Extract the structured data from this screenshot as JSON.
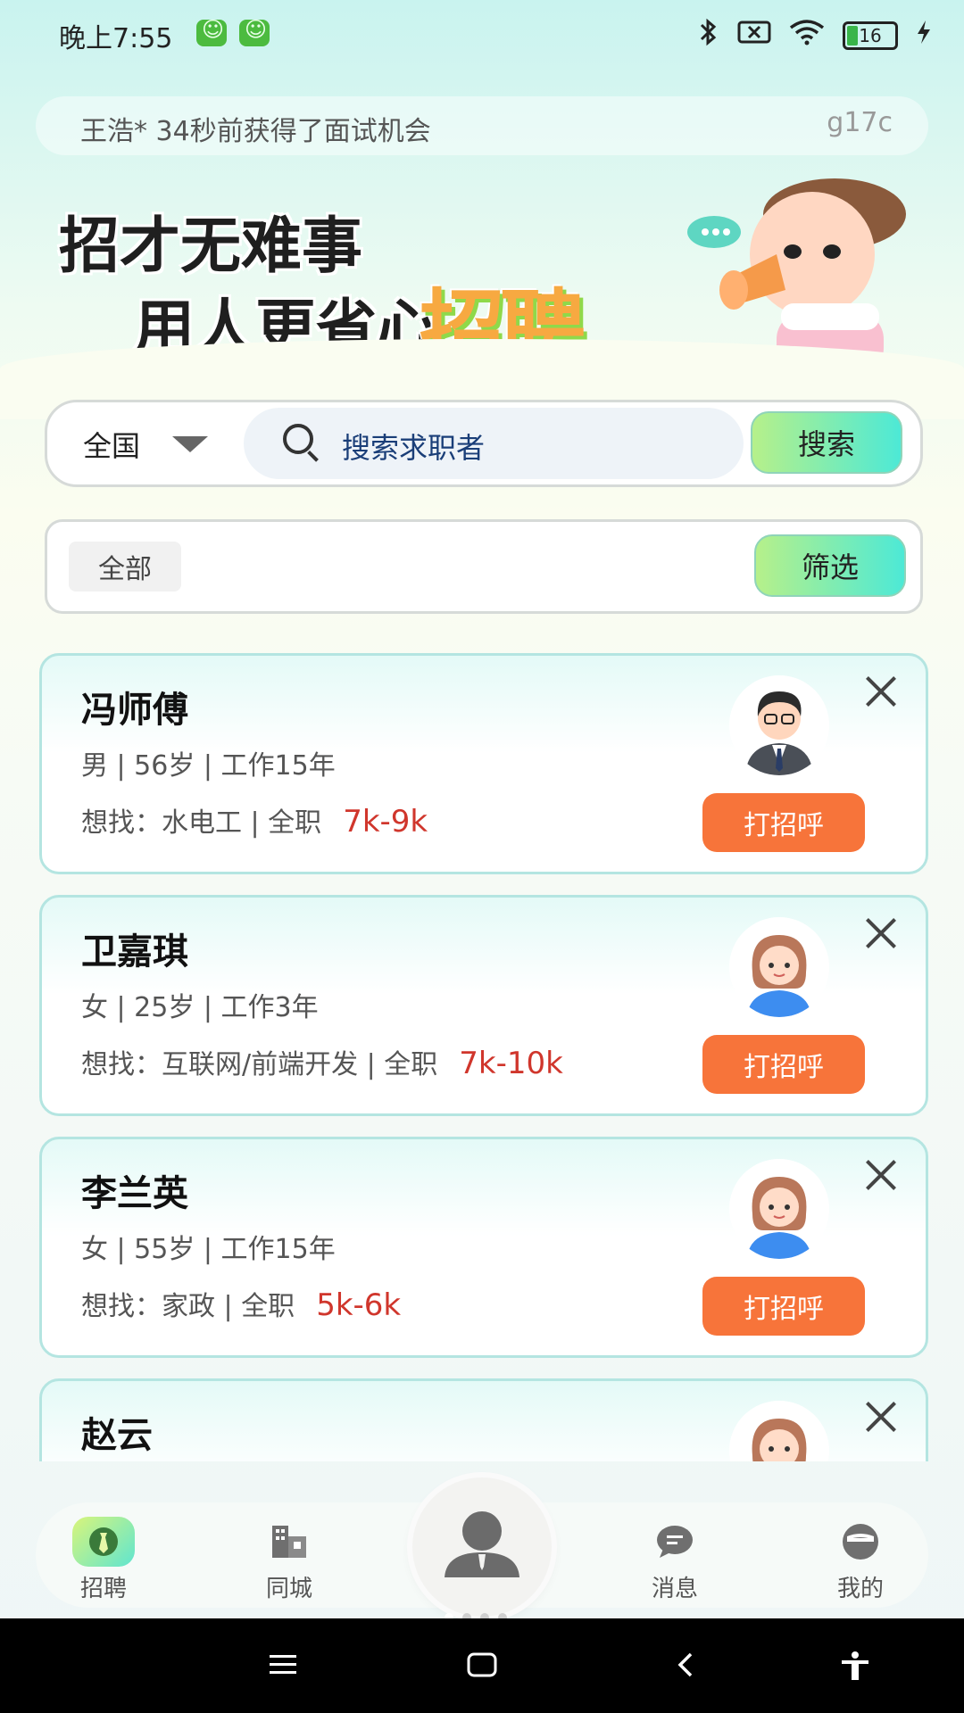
{
  "status_bar": {
    "time": "晚上7:55",
    "battery": "16",
    "icons": [
      "bluetooth-icon",
      "no-sim-icon",
      "wifi-icon",
      "battery-icon",
      "charging-icon"
    ]
  },
  "ticker": {
    "text": "王浩* 34秒前获得了面试机会",
    "code": "g17c"
  },
  "banner": {
    "line1": "招才无难事",
    "line2": "用人更省心",
    "word": "招聘"
  },
  "search": {
    "region": "全国",
    "placeholder": "搜索求职者",
    "button": "搜索"
  },
  "filter": {
    "chip": "全部",
    "button": "筛选"
  },
  "candidates": [
    {
      "name": "冯师傅",
      "meta": "男 | 56岁 | 工作15年",
      "want": "想找：水电工 | 全职",
      "salary": "7k-9k",
      "avatar": "male-avatar",
      "action": "打招呼"
    },
    {
      "name": "卫嘉琪",
      "meta": "女 | 25岁 | 工作3年",
      "want": "想找：互联网/前端开发 | 全职",
      "salary": "7k-10k",
      "avatar": "female-avatar",
      "action": "打招呼"
    },
    {
      "name": "李兰英",
      "meta": "女 | 55岁 | 工作15年",
      "want": "想找：家政 | 全职",
      "salary": "5k-6k",
      "avatar": "female-avatar",
      "action": "打招呼"
    },
    {
      "name": "赵云",
      "meta": "",
      "want": "",
      "salary": "",
      "avatar": "female-avatar",
      "action": ""
    }
  ],
  "tabs": [
    {
      "label": "招聘",
      "icon": "tie-icon"
    },
    {
      "label": "同城",
      "icon": "building-icon"
    },
    {
      "label": "消息",
      "icon": "chat-icon"
    },
    {
      "label": "我的",
      "icon": "profile-icon"
    }
  ],
  "colors": {
    "accent_orange": "#f7743a",
    "salary_red": "#d0362c",
    "card_border": "#b4e5e1"
  }
}
